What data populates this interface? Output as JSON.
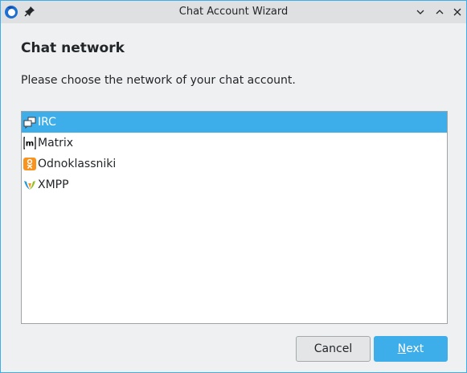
{
  "window": {
    "title": "Chat Account Wizard"
  },
  "page": {
    "heading": "Chat network",
    "instruction": "Please choose the network of your chat account."
  },
  "networks": [
    {
      "label": "IRC",
      "icon": "irc-icon",
      "selected": true
    },
    {
      "label": "Matrix",
      "icon": "matrix-icon",
      "selected": false
    },
    {
      "label": "Odnoklassniki",
      "icon": "odnoklassniki-icon",
      "selected": false
    },
    {
      "label": "XMPP",
      "icon": "xmpp-icon",
      "selected": false
    }
  ],
  "buttons": {
    "cancel": "Cancel",
    "next_mnemonic": "N",
    "next_rest": "ext"
  },
  "colors": {
    "accent": "#3daee9",
    "odnoklassniki": "#f7931e"
  }
}
